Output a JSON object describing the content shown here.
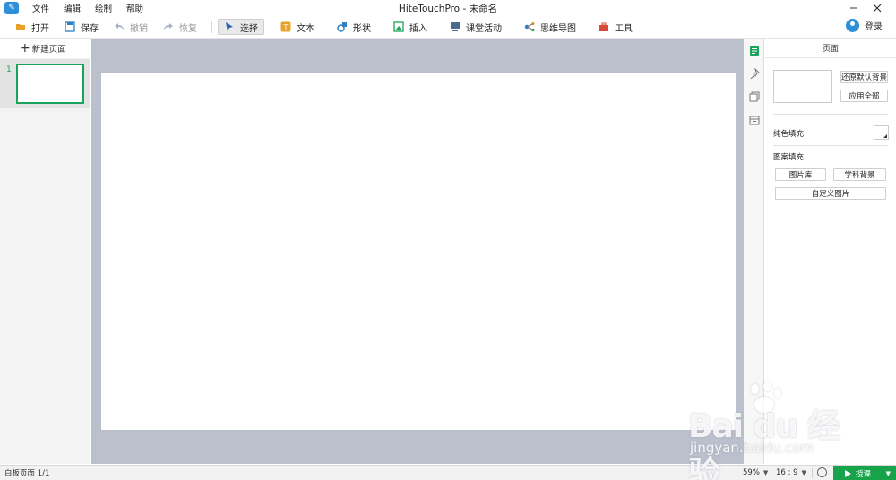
{
  "window": {
    "title": "HiteTouchPro - 未命名",
    "menus": [
      "文件",
      "编辑",
      "绘制",
      "帮助"
    ]
  },
  "toolbar": {
    "open": "打开",
    "save": "保存",
    "undo": "撤销",
    "redo": "恢复",
    "select": "选择",
    "text": "文本",
    "shape": "形状",
    "insert": "插入",
    "classroom": "课堂活动",
    "mindmap": "思维导图",
    "tools": "工具",
    "login": "登录"
  },
  "pages_panel": {
    "new_page": "新建页面",
    "pages": [
      {
        "number": "1"
      }
    ]
  },
  "properties_panel": {
    "title": "页面",
    "restore_default_bg": "还原默认背景",
    "apply_all": "应用全部",
    "solid_fill": "纯色填充",
    "pattern_fill": "图案填充",
    "image_library": "图片库",
    "subject_background": "学科背景",
    "custom_image": "自定义图片"
  },
  "status": {
    "page_info": "白板页面 1/1",
    "zoom": "59%",
    "aspect_ratio": "16 : 9",
    "present": "授课"
  },
  "watermark": {
    "main": "Bai du 经验",
    "sub": "jingyan.baidu.com"
  },
  "colors": {
    "accent_green": "#17a34a",
    "canvas_bg": "#bbc0cd",
    "brand_blue": "#2f8fd8"
  }
}
